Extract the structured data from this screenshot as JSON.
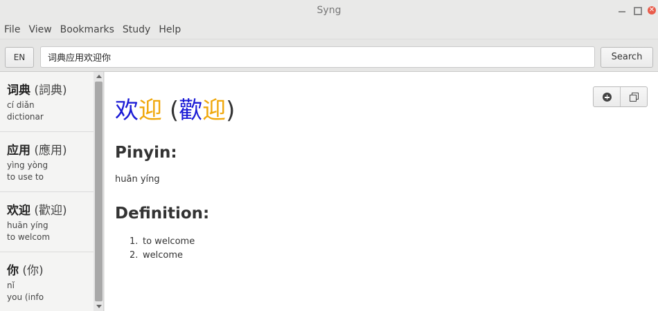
{
  "window": {
    "title": "Syng"
  },
  "menu": [
    "File",
    "View",
    "Bookmarks",
    "Study",
    "Help"
  ],
  "toolbar": {
    "lang_label": "EN",
    "search_value": "词典应用欢迎你",
    "search_label": "Search"
  },
  "results": [
    {
      "simplified": "词典",
      "traditional": "(詞典)",
      "pinyin": "cí diǎn",
      "meaning": "dictionar"
    },
    {
      "simplified": "应用",
      "traditional": "(應用)",
      "pinyin": "yìng yòng",
      "meaning": "to use to"
    },
    {
      "simplified": "欢迎",
      "traditional": "(歡迎)",
      "pinyin": "huān yíng",
      "meaning": "to welcom"
    },
    {
      "simplified": "你",
      "traditional": "(你)",
      "pinyin": "nǐ",
      "meaning": "you (info"
    }
  ],
  "entry": {
    "simp_1": "欢",
    "simp_2": "迎",
    "open_paren": "(",
    "trad_1": "歡",
    "trad_2": "迎",
    "close_paren": ")",
    "pinyin_heading": "Pinyin:",
    "pinyin": "huān yíng",
    "definition_heading": "Definition:",
    "definitions": [
      "to welcome",
      "welcome"
    ],
    "definition_numbers": [
      "1.",
      "2."
    ]
  },
  "colors": {
    "tone1": "#1b1bd6",
    "tone2": "#f0a70a",
    "close_button": "#e95c4b"
  },
  "icons": {
    "add": "plus-circle-icon",
    "copy": "copy-icon"
  }
}
